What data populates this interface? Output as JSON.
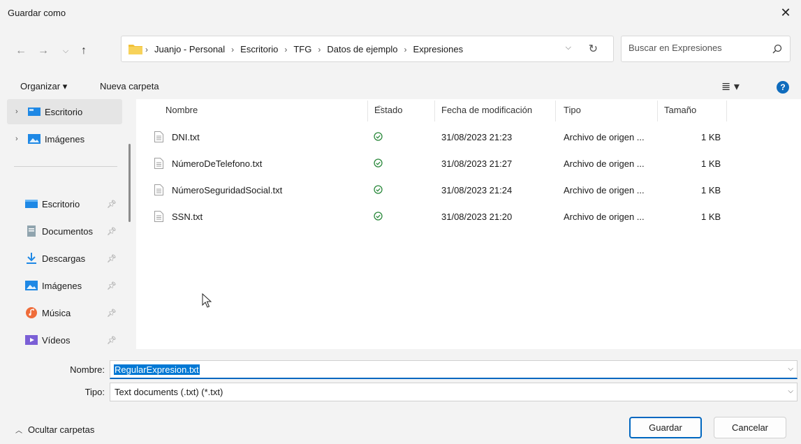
{
  "window": {
    "title": "Guardar como"
  },
  "breadcrumb": [
    "Juanjo - Personal",
    "Escritorio",
    "TFG",
    "Datos de ejemplo",
    "Expresiones"
  ],
  "search": {
    "placeholder": "Buscar en Expresiones"
  },
  "commandbar": {
    "organize": "Organizar ▾",
    "new_folder": "Nueva carpeta"
  },
  "sidebar": {
    "tree": [
      {
        "label": "Escritorio",
        "selected": true
      },
      {
        "label": "Imágenes",
        "selected": false
      }
    ],
    "quick_access": [
      {
        "label": "Escritorio",
        "icon": "desktop-icon"
      },
      {
        "label": "Documentos",
        "icon": "documents-icon"
      },
      {
        "label": "Descargas",
        "icon": "downloads-icon"
      },
      {
        "label": "Imágenes",
        "icon": "pictures-icon"
      },
      {
        "label": "Música",
        "icon": "music-icon"
      },
      {
        "label": "Vídeos",
        "icon": "videos-icon"
      }
    ]
  },
  "table": {
    "columns": [
      "Nombre",
      "Estado",
      "Fecha de modificación",
      "Tipo",
      "Tamaño"
    ],
    "rows": [
      {
        "name": "DNI.txt",
        "date": "31/08/2023 21:23",
        "type": "Archivo de origen ...",
        "size": "1 KB"
      },
      {
        "name": "NúmeroDeTelefono.txt",
        "date": "31/08/2023 21:27",
        "type": "Archivo de origen ...",
        "size": "1 KB"
      },
      {
        "name": "NúmeroSeguridadSocial.txt",
        "date": "31/08/2023 21:24",
        "type": "Archivo de origen ...",
        "size": "1 KB"
      },
      {
        "name": "SSN.txt",
        "date": "31/08/2023 21:20",
        "type": "Archivo de origen ...",
        "size": "1 KB"
      }
    ]
  },
  "footer": {
    "name_label": "Nombre:",
    "name_value": "RegularExpresion.txt",
    "type_label": "Tipo:",
    "type_value": "Text documents (.txt) (*.txt)",
    "hide_folders": "Ocultar carpetas",
    "save": "Guardar",
    "cancel": "Cancelar"
  },
  "colors": {
    "accent": "#0067c0",
    "status_ok": "#2d8a3e",
    "folder": "#f2c037"
  }
}
